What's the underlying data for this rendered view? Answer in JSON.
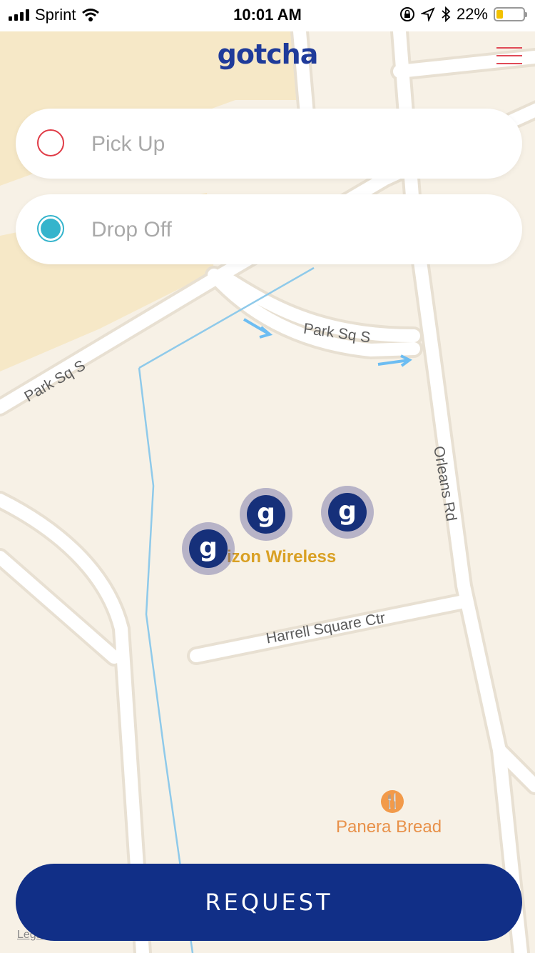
{
  "status_bar": {
    "carrier": "Sprint",
    "time": "10:01 AM",
    "battery_percent": "22%",
    "battery_level": 0.22,
    "icons": [
      "signal-icon",
      "wifi-icon",
      "orientation-lock-icon",
      "location-arrow-icon",
      "bluetooth-icon",
      "battery-icon"
    ]
  },
  "header": {
    "logo": "gotcha",
    "menu_icon": "hamburger-menu-icon",
    "accent_color": "#e04a57",
    "logo_color": "#1f3b9a"
  },
  "pickup": {
    "placeholder": "Pick Up",
    "value": "",
    "dot_color": "#e03c47"
  },
  "dropoff": {
    "placeholder": "Drop Off",
    "value": "",
    "dot_color": "#34b4cc"
  },
  "map": {
    "streets": [
      "Park Sq S",
      "Park Sq S",
      "Orleans Rd",
      "Harrell Square Ctr"
    ],
    "places": [
      {
        "name": "izon Wireless",
        "color": "#d9a024"
      },
      {
        "name": "Panera Bread",
        "color": "#e8914a",
        "icon": "fork-knife-icon"
      }
    ],
    "vehicles": [
      {
        "label": "g"
      },
      {
        "label": "g"
      },
      {
        "label": "g"
      }
    ],
    "legal": "Legal"
  },
  "actions": {
    "request_label": "REQUEST",
    "button_color": "#112f87"
  }
}
